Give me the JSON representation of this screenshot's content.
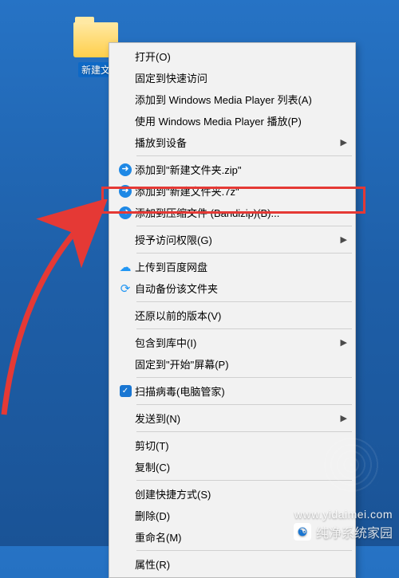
{
  "desktop": {
    "folder_label": "新建文"
  },
  "menu": {
    "open": "打开(O)",
    "pin_quick": "固定到快速访问",
    "add_wmp_list": "添加到 Windows Media Player 列表(A)",
    "play_wmp": "使用 Windows Media Player 播放(P)",
    "cast_to": "播放到设备",
    "add_zip": "添加到\"新建文件夹.zip\"",
    "add_7z": "添加到\"新建文件夹.7z\"",
    "add_archive": "添加到压缩文件 (Bandizip)(B)...",
    "grant_access": "授予访问权限(G)",
    "upload_baidu": "上传到百度网盘",
    "auto_backup": "自动备份该文件夹",
    "restore_prev": "还原以前的版本(V)",
    "include_lib": "包含到库中(I)",
    "pin_start": "固定到\"开始\"屏幕(P)",
    "scan_virus": "扫描病毒(电脑管家)",
    "send_to": "发送到(N)",
    "cut": "剪切(T)",
    "copy": "复制(C)",
    "create_shortcut": "创建快捷方式(S)",
    "delete": "删除(D)",
    "rename": "重命名(M)",
    "properties": "属性(R)"
  },
  "watermark": {
    "brand": "纯净系统家园",
    "url": "www.yidaimei.com"
  }
}
